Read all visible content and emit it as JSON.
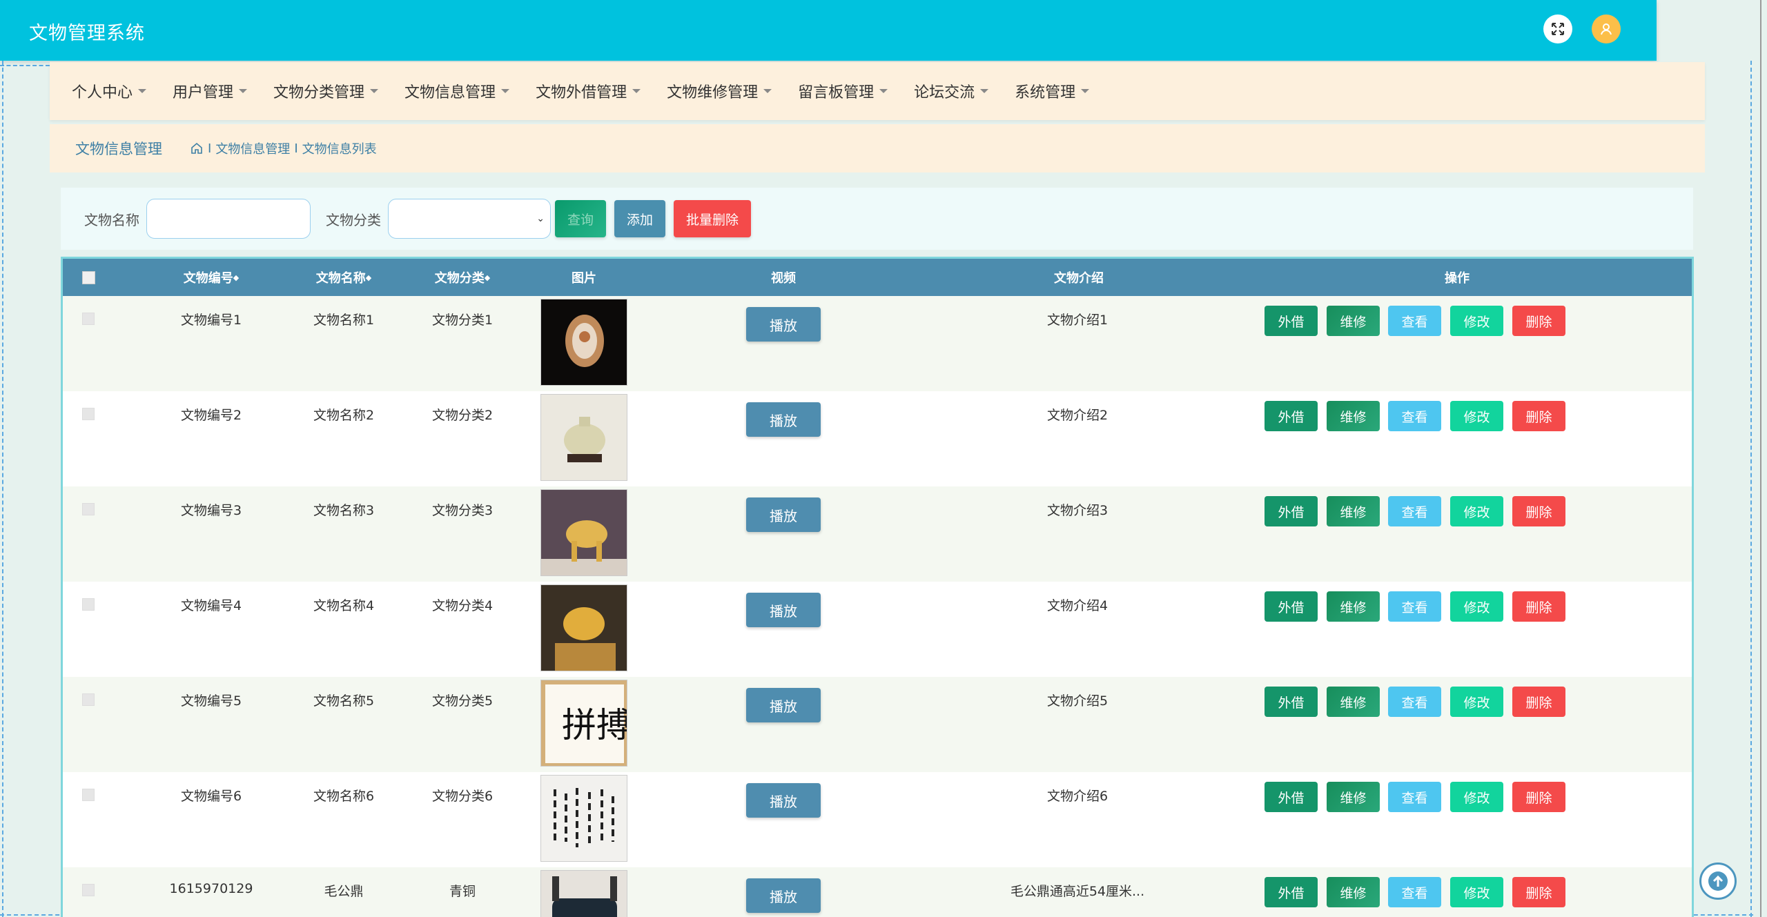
{
  "app": {
    "title": "文物管理系统"
  },
  "header": {
    "fullscreen_icon": "fullscreen-icon",
    "user_icon": "user-icon",
    "accent": "#00c2de",
    "user_color": "#fcbf49"
  },
  "nav": {
    "items": [
      {
        "label": "个人中心"
      },
      {
        "label": "用户管理"
      },
      {
        "label": "文物分类管理"
      },
      {
        "label": "文物信息管理"
      },
      {
        "label": "文物外借管理"
      },
      {
        "label": "文物维修管理"
      },
      {
        "label": "留言板管理"
      },
      {
        "label": "论坛交流"
      },
      {
        "label": "系统管理"
      }
    ]
  },
  "breadcrumb": {
    "title": "文物信息管理",
    "path": [
      "文物信息管理",
      "文物信息列表"
    ],
    "home_icon": "home-icon"
  },
  "search": {
    "name_label": "文物名称",
    "name_value": "",
    "category_label": "文物分类",
    "category_value": "",
    "search_button": "查询",
    "add_button": "添加",
    "batch_delete_button": "批量删除"
  },
  "table": {
    "headers": [
      "文物编号",
      "文物名称",
      "文物分类",
      "图片",
      "视频",
      "文物介绍",
      "操作"
    ],
    "sortable_marker": "◆",
    "play_label": "播放",
    "actions": {
      "lend": "外借",
      "repair": "维修",
      "view": "查看",
      "edit": "修改",
      "delete": "删除"
    },
    "rows": [
      {
        "code": "文物编号1",
        "name": "文物名称1",
        "category": "文物分类1",
        "intro": "文物介绍1"
      },
      {
        "code": "文物编号2",
        "name": "文物名称2",
        "category": "文物分类2",
        "intro": "文物介绍2"
      },
      {
        "code": "文物编号3",
        "name": "文物名称3",
        "category": "文物分类3",
        "intro": "文物介绍3"
      },
      {
        "code": "文物编号4",
        "name": "文物名称4",
        "category": "文物分类4",
        "intro": "文物介绍4"
      },
      {
        "code": "文物编号5",
        "name": "文物名称5",
        "category": "文物分类5",
        "intro": "文物介绍5"
      },
      {
        "code": "文物编号6",
        "name": "文物名称6",
        "category": "文物分类6",
        "intro": "文物介绍6"
      },
      {
        "code": "1615970129",
        "name": "毛公鼎",
        "category": "青铜",
        "intro": "毛公鼎通高近54厘米..."
      }
    ]
  },
  "back_to_top_icon": "arrow-up-icon"
}
